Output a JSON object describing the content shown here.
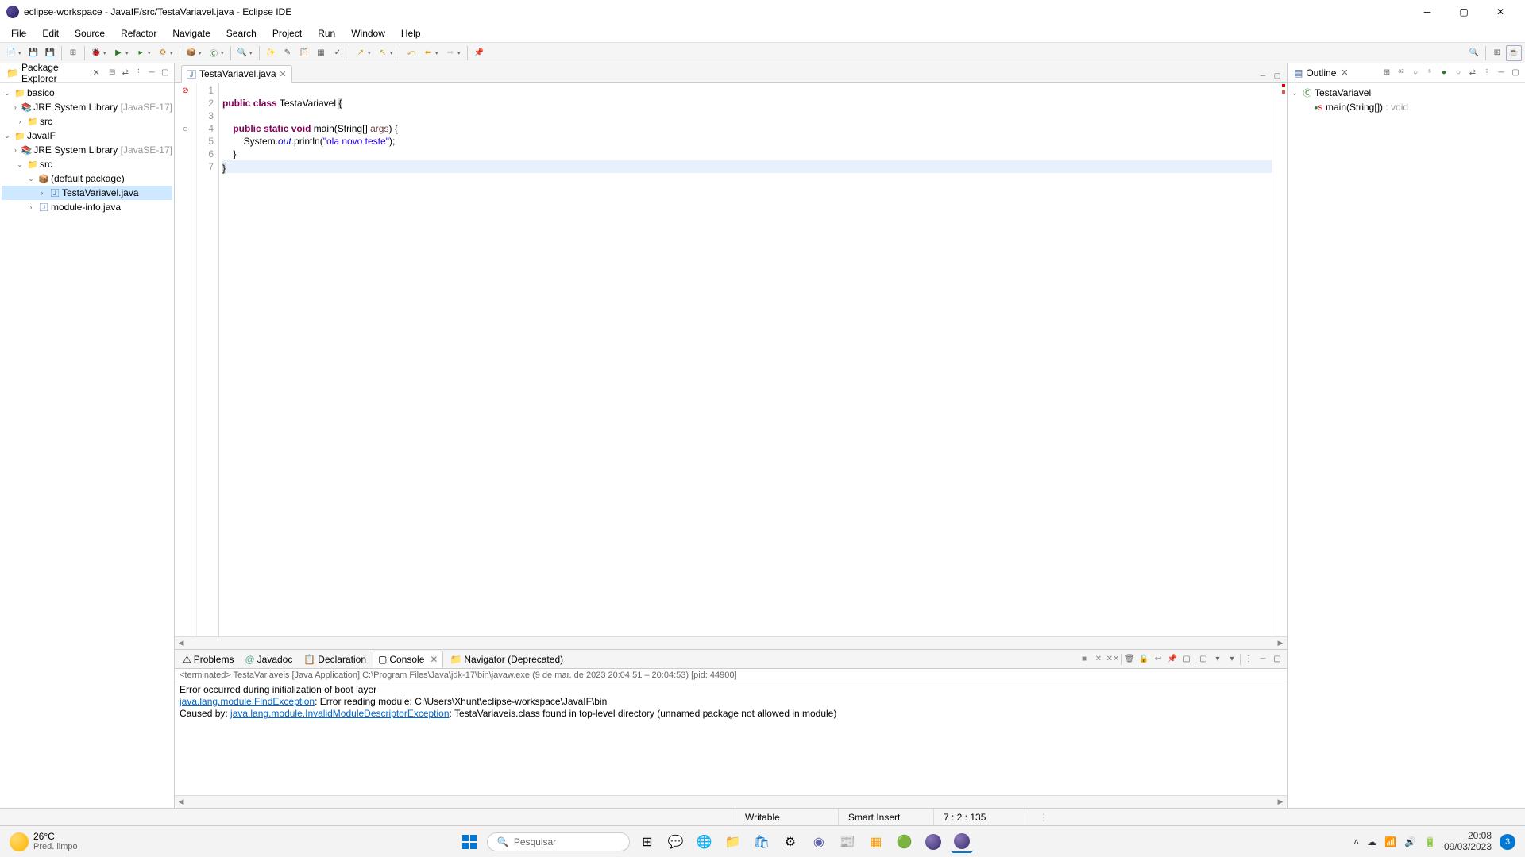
{
  "window": {
    "title": "eclipse-workspace - JavaIF/src/TestaVariavel.java - Eclipse IDE"
  },
  "menu": {
    "items": [
      "File",
      "Edit",
      "Source",
      "Refactor",
      "Navigate",
      "Search",
      "Project",
      "Run",
      "Window",
      "Help"
    ]
  },
  "package_explorer": {
    "title": "Package Explorer",
    "tree": {
      "basico": "basico",
      "jre1": "JRE System Library ",
      "jre1v": "[JavaSE-17]",
      "src1": "src",
      "javaif": "JavaIF",
      "jre2": "JRE System Library ",
      "jre2v": "[JavaSE-17]",
      "src2": "src",
      "defpkg": "(default package)",
      "file1": "TestaVariavel.java",
      "file2": "module-info.java"
    }
  },
  "editor": {
    "tab": "TestaVariavel.java",
    "lines": [
      "1",
      "2",
      "3",
      "4",
      "5",
      "6",
      "7"
    ],
    "code": {
      "l2_kw1": "public",
      "l2_kw2": "class",
      "l2_name": "TestaVariavel",
      "l2_br": "{",
      "l4_kw1": "public",
      "l4_kw2": "static",
      "l4_kw3": "void",
      "l4_name": "main(String[] ",
      "l4_arg": "args",
      "l4_end": ") {",
      "l5_pre": "        System.",
      "l5_out": "out",
      "l5_mid": ".println(",
      "l5_str": "\"ola novo teste\"",
      "l5_end": ");",
      "l6": "    }",
      "l7": "}"
    }
  },
  "outline": {
    "title": "Outline",
    "class": "TestaVariavel",
    "method": "main(String[]) ",
    "rettype": ": void"
  },
  "bottom_tabs": {
    "problems": "Problems",
    "javadoc": "Javadoc",
    "declaration": "Declaration",
    "console": "Console",
    "navigator": "Navigator (Deprecated)"
  },
  "console": {
    "info": "<terminated> TestaVariaveis [Java Application] C:\\Program Files\\Java\\jdk-17\\bin\\javaw.exe  (9 de mar. de 2023 20:04:51 – 20:04:53) [pid: 44900]",
    "l1": "Error occurred during initialization of boot layer",
    "l2a": "java.lang.module.FindException",
    "l2b": ": Error reading module: C:\\Users\\Xhunt\\eclipse-workspace\\JavaIF\\bin",
    "l3a": "Caused by: ",
    "l3b": "java.lang.module.InvalidModuleDescriptorException",
    "l3c": ": TestaVariaveis.class found in top-level directory (unnamed package not allowed in module)"
  },
  "status": {
    "writable": "Writable",
    "insert": "Smart Insert",
    "pos": "7 : 2 : 135"
  },
  "taskbar": {
    "temp": "26°C",
    "cond": "Pred. limpo",
    "search": "Pesquisar",
    "time": "20:08",
    "date": "09/03/2023",
    "notif": "3"
  }
}
